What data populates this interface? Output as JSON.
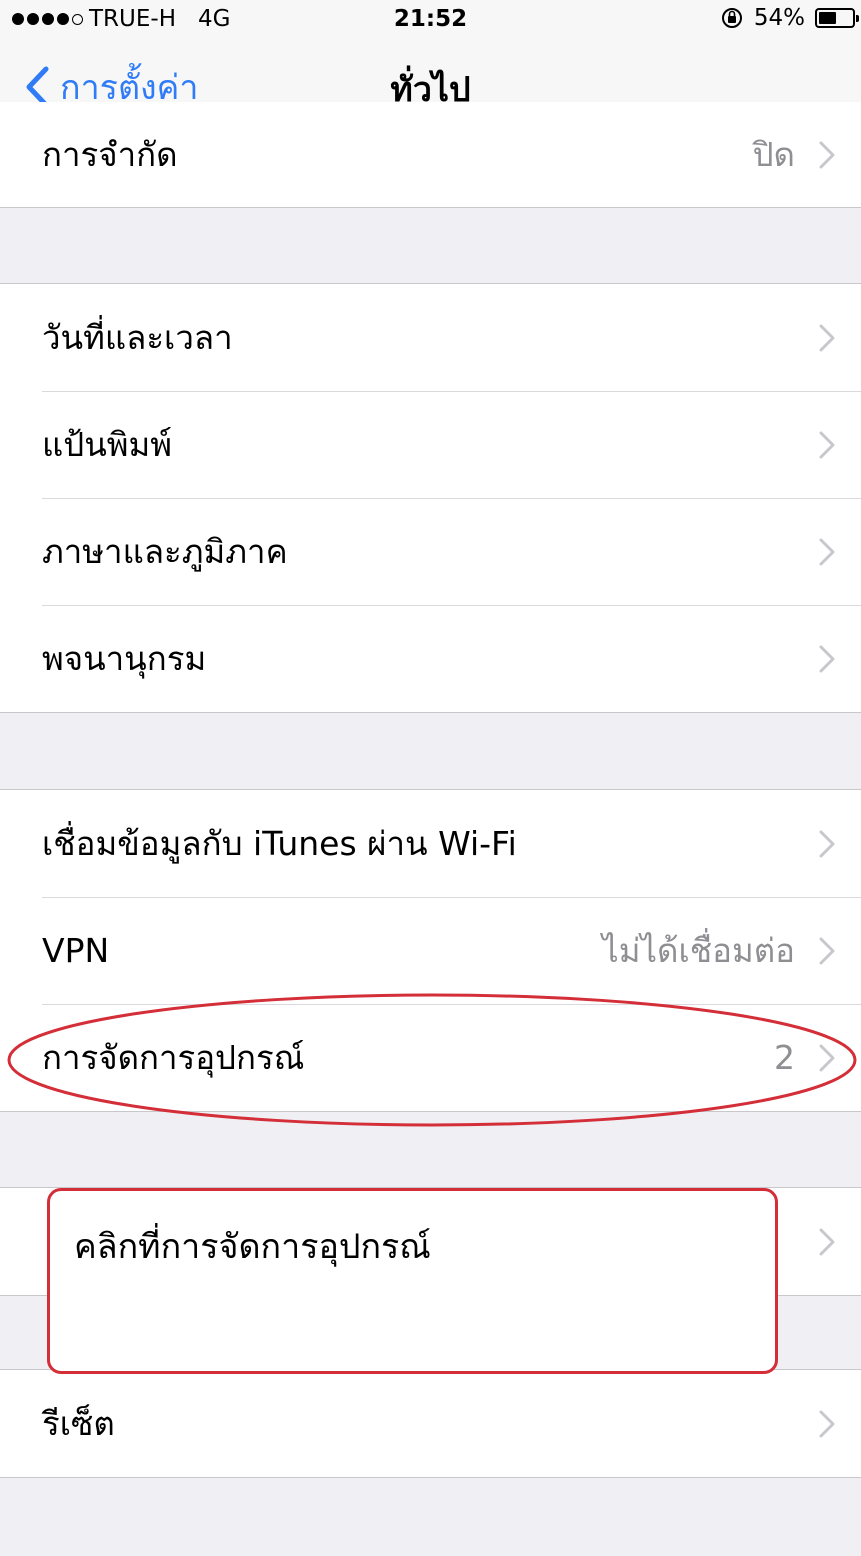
{
  "status_bar": {
    "carrier": "TRUE-H",
    "network": "4G",
    "time": "21:52",
    "battery": "54%",
    "battery_level": 0.54
  },
  "nav": {
    "back_label": "การตั้งค่า",
    "title": "ทั่วไป"
  },
  "groups": [
    {
      "rows": [
        {
          "label": "การจำกัด",
          "value": "ปิด"
        }
      ]
    },
    {
      "rows": [
        {
          "label": "วันที่และเวลา",
          "value": ""
        },
        {
          "label": "แป้นพิมพ์",
          "value": ""
        },
        {
          "label": "ภาษาและภูมิภาค",
          "value": ""
        },
        {
          "label": "พจนานุกรม",
          "value": ""
        }
      ]
    },
    {
      "rows": [
        {
          "label": "เชื่อมข้อมูลกับ iTunes ผ่าน Wi-Fi",
          "value": ""
        },
        {
          "label": "VPN",
          "value": "ไม่ได้เชื่อมต่อ"
        },
        {
          "label": "การจัดการอุปกรณ์",
          "value": "2"
        }
      ]
    },
    {
      "rows": [
        {
          "label": "",
          "value": ""
        }
      ]
    },
    {
      "rows": [
        {
          "label": "รีเซ็ต",
          "value": ""
        }
      ]
    }
  ],
  "annotation": {
    "callout_text": "คลิกที่การจัดการอุปกรณ์",
    "highlight_color": "#d42e39"
  }
}
